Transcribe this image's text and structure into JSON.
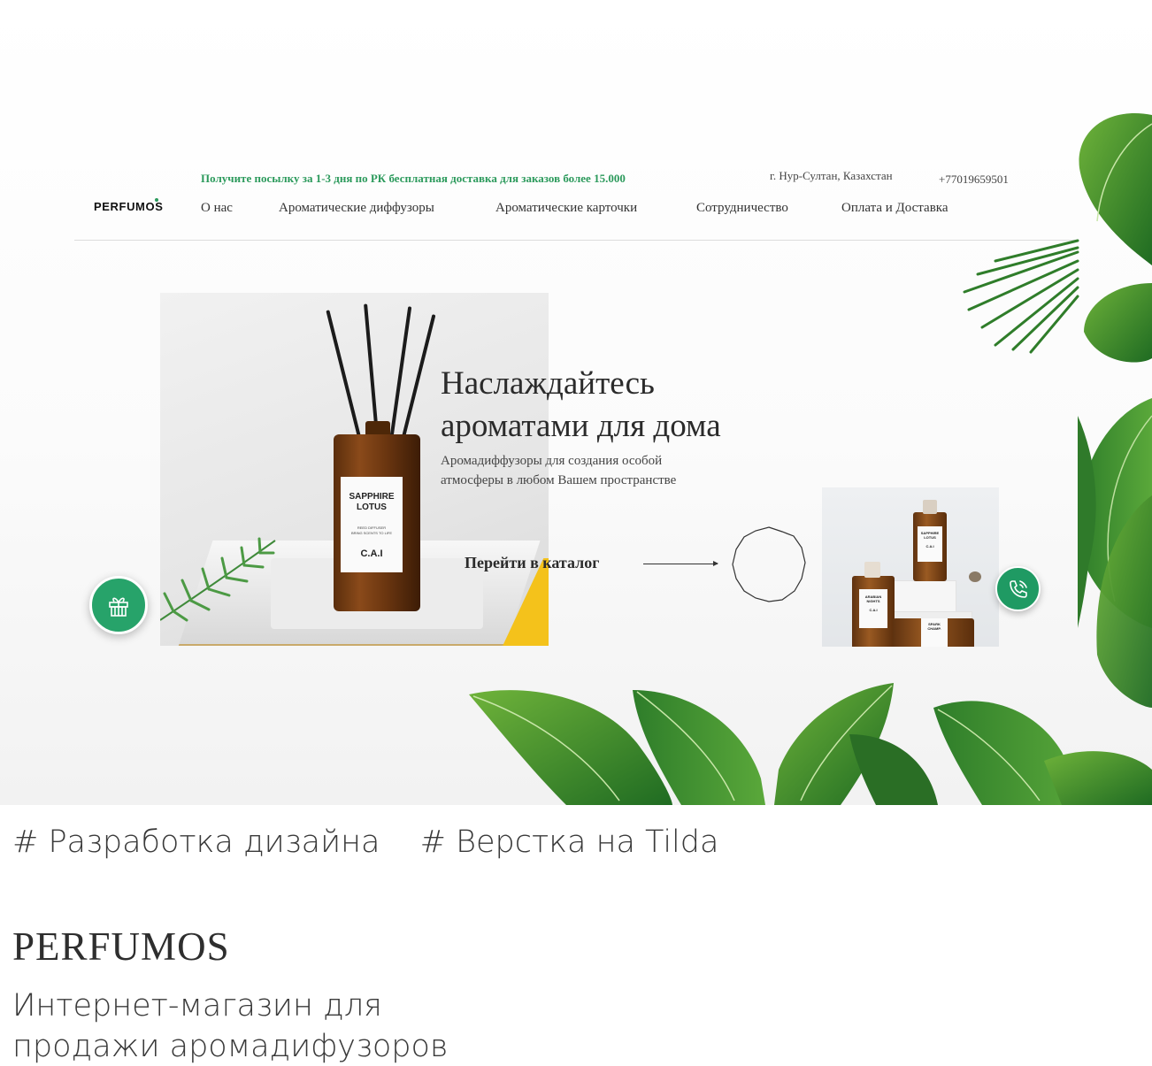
{
  "header": {
    "promo": "Получите посылку за 1-3 дня по РК бесплатная доставка для заказов более 15.000",
    "city": "г. Нур-Султан, Казахстан",
    "phone": "+77019659501",
    "logo": "PERFUMOS"
  },
  "nav": {
    "items": [
      {
        "label": "О нас"
      },
      {
        "label": "Ароматические диффузоры"
      },
      {
        "label": "Ароматические карточки"
      },
      {
        "label": "Сотрудничество"
      },
      {
        "label": "Оплата и Доставка"
      }
    ]
  },
  "hero": {
    "title_line1": "Наслаждайтесь",
    "title_line2": "ароматами для дома",
    "subtitle_line1": "Аромадиффузоры для создания особой",
    "subtitle_line2": "атмосферы в любом Вашем пространстве",
    "catalog_link": "Перейти в каталог",
    "product_label": {
      "name_line1": "SAPPHIRE",
      "name_line2": "LOTUS",
      "small1": "REED DIFFUSER",
      "small2": "BRING SCENTS TO LIFE",
      "brand": "C.A.I"
    },
    "side_labels": [
      "SAPPHIRE LOTUS",
      "ARABIAN NIGHTS",
      "SPARK CHAMPAGNE",
      "C.A.I"
    ]
  },
  "icons": {
    "gift": "gift-icon",
    "call": "phone-call-icon"
  },
  "colors": {
    "accent": "#2c9a5c",
    "button": "#27a36a"
  },
  "portfolio": {
    "tags": [
      "# Разработка дизайна",
      "# Верстка на Tilda"
    ],
    "title": "PERFUMOS",
    "description_line1": "Интернет-магазин для",
    "description_line2": "продажи аромадифузоров"
  }
}
